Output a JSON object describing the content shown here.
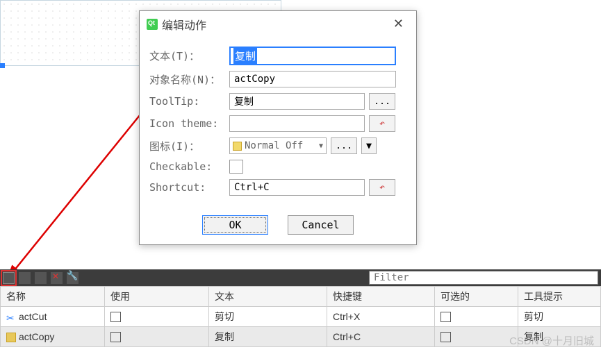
{
  "dialog": {
    "title": "编辑动作",
    "fields": {
      "text_label": "文本(T)：",
      "text_value": "复制",
      "objname_label": "对象名称(N)：",
      "objname_value": "actCopy",
      "tooltip_label": "ToolTip:",
      "tooltip_value": "复制",
      "tooltip_more": "...",
      "icontheme_label": "Icon theme:",
      "icontheme_value": "",
      "icontheme_reset": "↶",
      "icon_label": "图标(I)：",
      "icon_combo_value": "Normal Off",
      "icon_more": "...",
      "checkable_label": "Checkable:",
      "shortcut_label": "Shortcut:",
      "shortcut_value": "Ctrl+C",
      "shortcut_reset": "↶"
    },
    "buttons": {
      "ok": "OK",
      "cancel": "Cancel"
    }
  },
  "toolbar": {
    "filter_placeholder": "Filter"
  },
  "table": {
    "headers": {
      "name": "名称",
      "used": "使用",
      "text": "文本",
      "shortcut": "快捷键",
      "checkable": "可选的",
      "tooltip": "工具提示"
    },
    "rows": [
      {
        "icon": "cut",
        "name": "actCut",
        "text": "剪切",
        "shortcut": "Ctrl+X",
        "tooltip": "剪切"
      },
      {
        "icon": "copy",
        "name": "actCopy",
        "text": "复制",
        "shortcut": "Ctrl+C",
        "tooltip": "复制"
      }
    ]
  },
  "watermark": "CSDN @十月旧城"
}
